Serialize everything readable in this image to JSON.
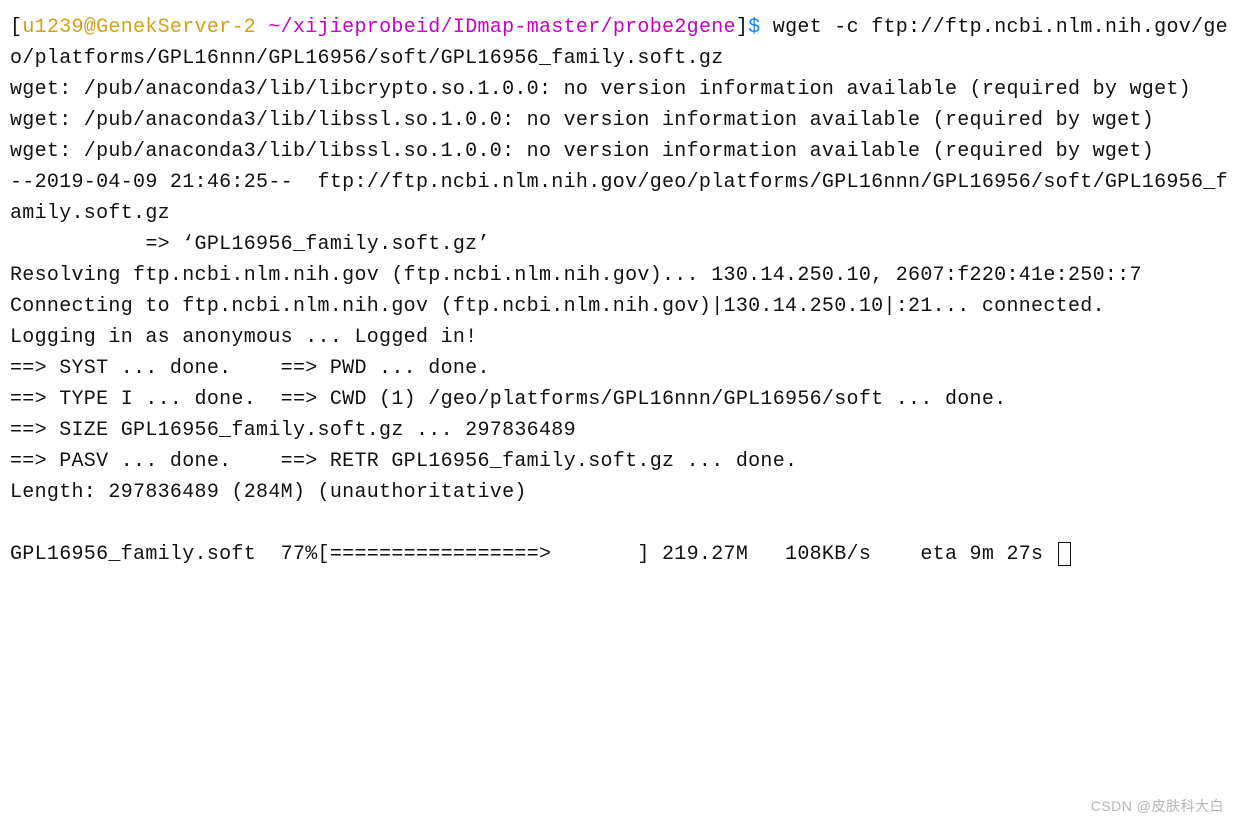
{
  "prompt": {
    "open_bracket": "[",
    "user_host": "u1239@GenekServer-2",
    "space": " ",
    "path": "~/xijieprobeid/IDmap-master/probe2gene",
    "close_bracket": "]",
    "dollar": "$"
  },
  "command": " wget -c ftp://ftp.ncbi.nlm.nih.gov/geo/platforms/GPL16nnn/GPL16956/soft/GPL16956_family.soft.gz",
  "lines": {
    "l01": "wget: /pub/anaconda3/lib/libcrypto.so.1.0.0: no version information available (required by wget)",
    "l02": "wget: /pub/anaconda3/lib/libssl.so.1.0.0: no version information available (required by wget)",
    "l03": "wget: /pub/anaconda3/lib/libssl.so.1.0.0: no version information available (required by wget)",
    "l04": "--2019-04-09 21:46:25--  ftp://ftp.ncbi.nlm.nih.gov/geo/platforms/GPL16nnn/GPL16956/soft/GPL16956_family.soft.gz",
    "l05": "           => ‘GPL16956_family.soft.gz’",
    "l06": "Resolving ftp.ncbi.nlm.nih.gov (ftp.ncbi.nlm.nih.gov)... 130.14.250.10, 2607:f220:41e:250::7",
    "l07": "Connecting to ftp.ncbi.nlm.nih.gov (ftp.ncbi.nlm.nih.gov)|130.14.250.10|:21... connected.",
    "l08": "Logging in as anonymous ... Logged in!",
    "l09": "==> SYST ... done.    ==> PWD ... done.",
    "l10": "==> TYPE I ... done.  ==> CWD (1) /geo/platforms/GPL16nnn/GPL16956/soft ... done.",
    "l11": "==> SIZE GPL16956_family.soft.gz ... 297836489",
    "l12": "==> PASV ... done.    ==> RETR GPL16956_family.soft.gz ... done.",
    "l13": "Length: 297836489 (284M) (unauthoritative)",
    "blank": "",
    "progress": "GPL16956_family.soft  77%[=================>       ] 219.27M   108KB/s    eta 9m 27s "
  },
  "watermark": "CSDN @皮肤科大白"
}
